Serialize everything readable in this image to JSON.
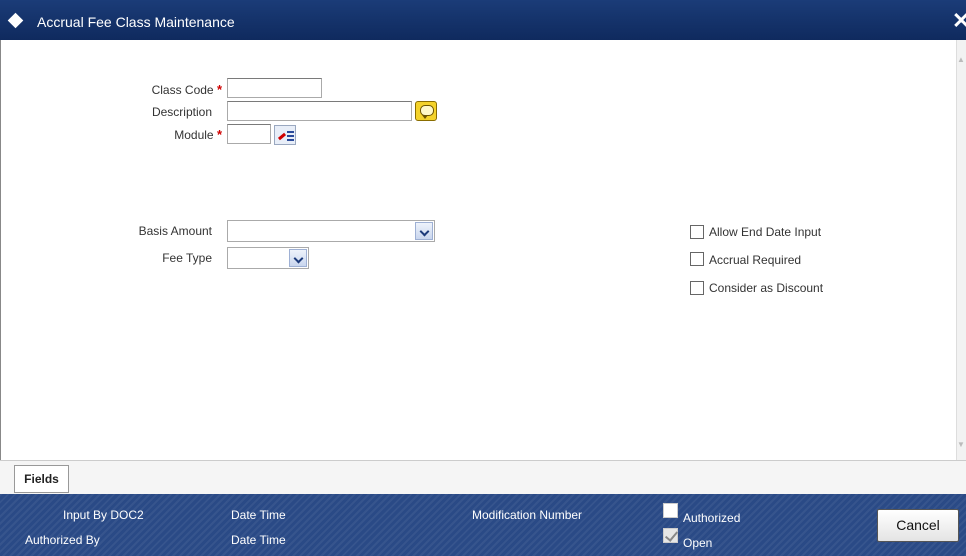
{
  "window": {
    "title": "Accrual Fee Class Maintenance"
  },
  "form": {
    "class_code_label": "Class Code",
    "class_code_value": "",
    "description_label": "Description",
    "description_value": "",
    "module_label": "Module",
    "module_value": "",
    "required_marker": "*",
    "basis_amount_label": "Basis Amount",
    "basis_amount_value": "",
    "fee_type_label": "Fee Type",
    "fee_type_value": ""
  },
  "options": {
    "allow_end_date_input": {
      "label": "Allow End Date Input",
      "checked": false
    },
    "accrual_required": {
      "label": "Accrual Required",
      "checked": false
    },
    "consider_as_discount": {
      "label": "Consider as Discount",
      "checked": false
    }
  },
  "tabs": {
    "fields_label": "Fields"
  },
  "footer": {
    "input_by_label": "Input By DOC2",
    "authorized_by_label": "Authorized By",
    "date_time_label_1": "Date Time",
    "date_time_label_2": "Date Time",
    "modification_number_label": "Modification Number",
    "authorized_label": "Authorized",
    "authorized_checked": false,
    "open_label": "Open",
    "open_checked": true,
    "cancel_label": "Cancel"
  },
  "icons": {
    "window": "diamond-icon",
    "close": "close-icon",
    "description_button": "comment-icon",
    "module_button": "list-of-values-icon",
    "dropdown": "chevron-down-icon"
  },
  "colors": {
    "titlebar": "#1b3c78",
    "footer": "#2a4a86",
    "required": "#d00000"
  }
}
